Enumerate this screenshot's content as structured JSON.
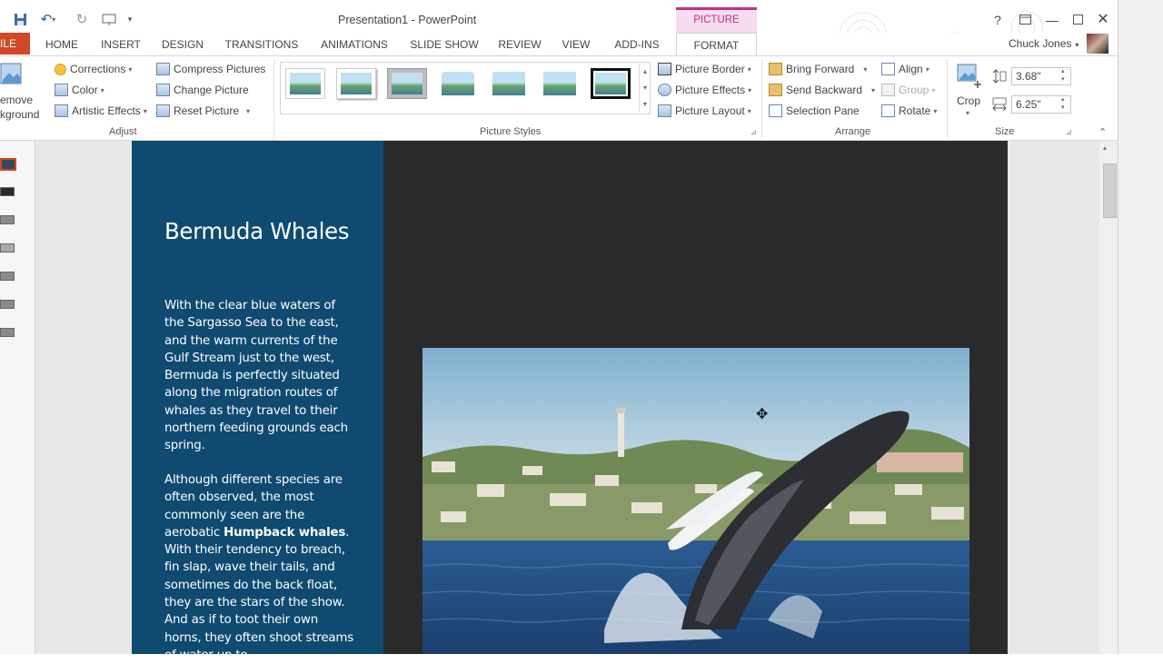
{
  "window": {
    "title": "Presentation1 - PowerPoint",
    "context_tab_group": "PICTURE TOOLS",
    "help": "?",
    "user": "Chuck Jones"
  },
  "tabs": [
    "ILE",
    "HOME",
    "INSERT",
    "DESIGN",
    "TRANSITIONS",
    "ANIMATIONS",
    "SLIDE SHOW",
    "REVIEW",
    "VIEW",
    "ADD-INS",
    "FORMAT"
  ],
  "ribbon": {
    "adjust": {
      "remove_bg_1": "emove",
      "remove_bg_2": "kground",
      "corrections": "Corrections",
      "color": "Color",
      "artistic": "Artistic Effects",
      "compress": "Compress Pictures",
      "change": "Change Picture",
      "reset": "Reset Picture",
      "label": "Adjust"
    },
    "styles": {
      "border": "Picture Border",
      "effects": "Picture Effects",
      "layout": "Picture Layout",
      "label": "Picture Styles"
    },
    "arrange": {
      "bring_forward": "Bring Forward",
      "send_backward": "Send Backward",
      "selection_pane": "Selection Pane",
      "align": "Align",
      "group": "Group",
      "rotate": "Rotate",
      "label": "Arrange"
    },
    "size": {
      "crop": "Crop",
      "height": "3.68\"",
      "width": "6.25\"",
      "label": "Size"
    }
  },
  "slide": {
    "title": "Bermuda Whales",
    "para1": "With the clear blue waters of the Sargasso Sea to the east, and the warm currents of the Gulf Stream just to the west, Bermuda is perfectly situated along the migration routes of whales as they travel to their northern feeding grounds each spring.",
    "para2_before": "Although different species are often observed, the most commonly seen are the aerobatic ",
    "para2_bold": "Humpback whales",
    "para2_after": ". With their tendency to breach, fin slap, wave their tails, and sometimes do the back float, they are the stars of the show. And as if to toot their own horns, they often shoot streams of water up to"
  },
  "colors": {
    "accent": "#d24726",
    "picture_tools": "#c4307b",
    "slide_panel": "#0f4a70",
    "slide_bg": "#2b2a2b"
  }
}
